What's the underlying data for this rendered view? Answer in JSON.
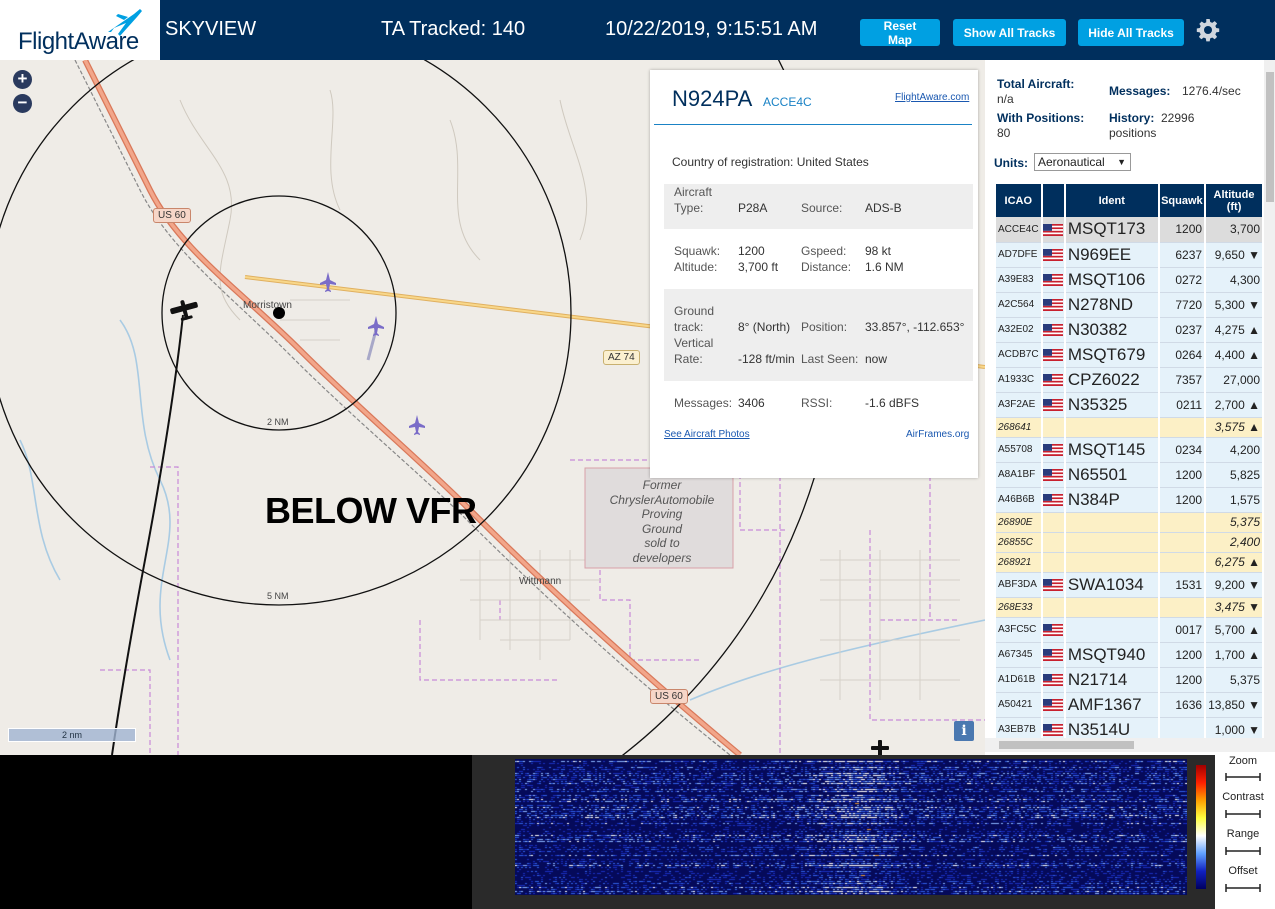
{
  "header": {
    "logo_text": "FlightAware",
    "app_name": "SKYVIEW",
    "ta_tracked": "TA Tracked: 140",
    "datetime": "10/22/2019, 9:15:51 AM",
    "reset_map": "Reset Map",
    "show_all": "Show All Tracks",
    "hide_all": "Hide All Tracks"
  },
  "map": {
    "zoom_in": "+",
    "zoom_out": "−",
    "labels": {
      "us60_top": "US 60",
      "us60_bottom": "US 60",
      "az74": "AZ 74",
      "morristown": "Morristown",
      "wittmann": "Wittmann",
      "ring_2nm": "2 NM",
      "ring_5nm": "5 NM",
      "below_vfr": "BELOW VFR",
      "proving_ground": [
        "Former",
        "ChryslerAutomobile",
        "Proving",
        "Ground",
        "sold to",
        "developers"
      ],
      "scale": "2 nm",
      "info": "i"
    }
  },
  "selected": {
    "ident": "N924PA",
    "icao": "ACCE4C",
    "fa_link": "FlightAware.com",
    "country_label": "Country of registration:",
    "country": "United States",
    "aircraft_type_label1": "Aircraft",
    "aircraft_type_label2": "Type:",
    "aircraft_type": "P28A",
    "source_label": "Source:",
    "source": "ADS-B",
    "squawk_label": "Squawk:",
    "squawk": "1200",
    "gspeed_label": "Gspeed:",
    "gspeed": "98 kt",
    "altitude_label": "Altitude:",
    "altitude": "3,700 ft",
    "distance_label": "Distance:",
    "distance": "1.6 NM",
    "ground_label1": "Ground",
    "ground_label2": "track:",
    "track": "8° (North)",
    "position_label": "Position:",
    "position": "33.857°, -112.653°",
    "vert_label1": "Vertical",
    "vert_label2": "Rate:",
    "vert_rate": "-128 ft/min",
    "last_seen_label": "Last Seen:",
    "last_seen": "now",
    "messages_label": "Messages:",
    "messages": "3406",
    "rssi_label": "RSSI:",
    "rssi": "-1.6 dBFS",
    "photos_link": "See Aircraft Photos",
    "airframes_link": "AirFrames.org"
  },
  "stats": {
    "total_label": "Total Aircraft:",
    "total": "n/a",
    "messages_label": "Messages:",
    "messages": "1276.4/sec",
    "positions_label": "With Positions:",
    "positions": "80",
    "history_label": "History:",
    "history": "22996",
    "history_unit": "positions",
    "units_label": "Units:",
    "units_value": "Aeronautical"
  },
  "table": {
    "headers": {
      "icao": "ICAO",
      "ident": "Ident",
      "squawk": "Squawk",
      "alt1": "Altitude",
      "alt2": "(ft)"
    },
    "rows": [
      {
        "icao": "ACCE4C",
        "flag": true,
        "ident": "MSQT173",
        "squawk": "1200",
        "alt": "3,700",
        "kind": "sel"
      },
      {
        "icao": "AD7DFE",
        "flag": true,
        "ident": "N969EE",
        "squawk": "6237",
        "alt": "9,650 ▼",
        "kind": ""
      },
      {
        "icao": "A39E83",
        "flag": true,
        "ident": "MSQT106",
        "squawk": "0272",
        "alt": "4,300",
        "kind": ""
      },
      {
        "icao": "A2C564",
        "flag": true,
        "ident": "N278ND",
        "squawk": "7720",
        "alt": "5,300 ▼",
        "kind": ""
      },
      {
        "icao": "A32E02",
        "flag": true,
        "ident": "N30382",
        "squawk": "0237",
        "alt": "4,275 ▲",
        "kind": ""
      },
      {
        "icao": "ACDB7C",
        "flag": true,
        "ident": "MSQT679",
        "squawk": "0264",
        "alt": "4,400 ▲",
        "kind": ""
      },
      {
        "icao": "A1933C",
        "flag": true,
        "ident": "CPZ6022",
        "squawk": "7357",
        "alt": "27,000",
        "kind": ""
      },
      {
        "icao": "A3F2AE",
        "flag": true,
        "ident": "N35325",
        "squawk": "0211",
        "alt": "2,700 ▲",
        "kind": ""
      },
      {
        "icao": "268641",
        "flag": false,
        "ident": "",
        "squawk": "",
        "alt": "3,575 ▲",
        "kind": "nopos"
      },
      {
        "icao": "A55708",
        "flag": true,
        "ident": "MSQT145",
        "squawk": "0234",
        "alt": "4,200",
        "kind": ""
      },
      {
        "icao": "A8A1BF",
        "flag": true,
        "ident": "N65501",
        "squawk": "1200",
        "alt": "5,825",
        "kind": ""
      },
      {
        "icao": "A46B6B",
        "flag": true,
        "ident": "N384P",
        "squawk": "1200",
        "alt": "1,575",
        "kind": ""
      },
      {
        "icao": "26890E",
        "flag": false,
        "ident": "",
        "squawk": "",
        "alt": "5,375",
        "kind": "nopos"
      },
      {
        "icao": "26855C",
        "flag": false,
        "ident": "",
        "squawk": "",
        "alt": "2,400",
        "kind": "nopos"
      },
      {
        "icao": "268921",
        "flag": false,
        "ident": "",
        "squawk": "",
        "alt": "6,275 ▲",
        "kind": "nopos"
      },
      {
        "icao": "ABF3DA",
        "flag": true,
        "ident": "SWA1034",
        "squawk": "1531",
        "alt": "9,200 ▼",
        "kind": ""
      },
      {
        "icao": "268E33",
        "flag": false,
        "ident": "",
        "squawk": "",
        "alt": "3,475 ▼",
        "kind": "nopos"
      },
      {
        "icao": "A3FC5C",
        "flag": true,
        "ident": "",
        "squawk": "0017",
        "alt": "5,700 ▲",
        "kind": ""
      },
      {
        "icao": "A67345",
        "flag": true,
        "ident": "MSQT940",
        "squawk": "1200",
        "alt": "1,700 ▲",
        "kind": ""
      },
      {
        "icao": "A1D61B",
        "flag": true,
        "ident": "N21714",
        "squawk": "1200",
        "alt": "5,375",
        "kind": ""
      },
      {
        "icao": "A50421",
        "flag": true,
        "ident": "AMF1367",
        "squawk": "1636",
        "alt": "13,850 ▼",
        "kind": ""
      },
      {
        "icao": "A3EB7B",
        "flag": true,
        "ident": "N3514U",
        "squawk": "",
        "alt": "1,000 ▼",
        "kind": ""
      }
    ]
  },
  "waterfall": {
    "zoom": "Zoom",
    "contrast": "Contrast",
    "range": "Range",
    "offset": "Offset"
  },
  "colors": {
    "header_bg": "#002f5d",
    "button_bg": "#00a0e2",
    "table_header": "#002f5d",
    "row_bg": "#e5f2fa",
    "nopos_bg": "#fcf0c6"
  }
}
